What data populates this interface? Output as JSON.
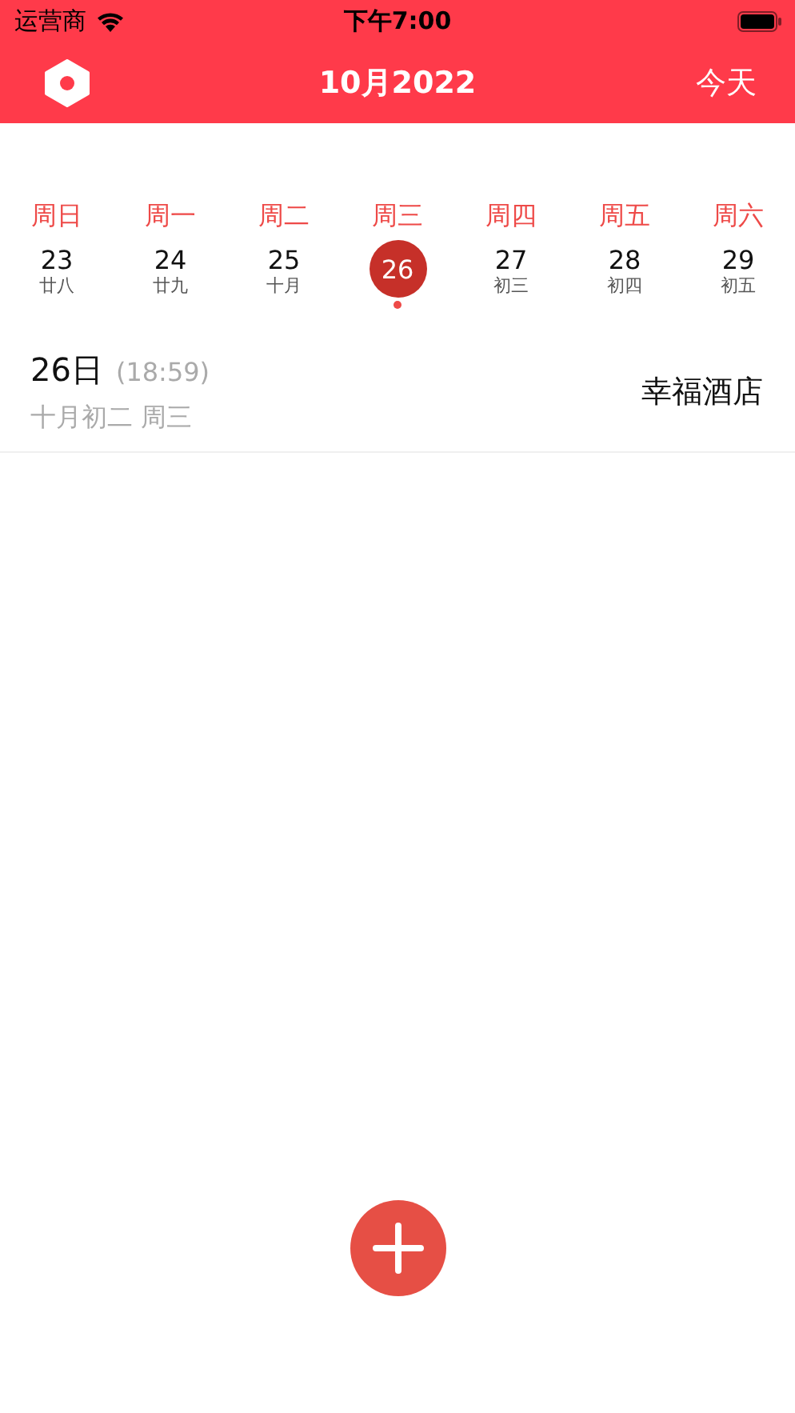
{
  "status_bar": {
    "carrier": "运营商",
    "time": "下午7:00"
  },
  "header": {
    "title": "10月2022",
    "today_button": "今天"
  },
  "weekdays": [
    "周日",
    "周一",
    "周二",
    "周三",
    "周四",
    "周五",
    "周六"
  ],
  "days": [
    {
      "date": "23",
      "lunar": "廿八",
      "selected": false,
      "has_event": false
    },
    {
      "date": "24",
      "lunar": "廿九",
      "selected": false,
      "has_event": false
    },
    {
      "date": "25",
      "lunar": "十月",
      "selected": false,
      "has_event": false
    },
    {
      "date": "26",
      "selected": true,
      "has_event": true
    },
    {
      "date": "27",
      "lunar": "初三",
      "selected": false,
      "has_event": false
    },
    {
      "date": "28",
      "lunar": "初四",
      "selected": false,
      "has_event": false
    },
    {
      "date": "29",
      "lunar": "初五",
      "selected": false,
      "has_event": false
    }
  ],
  "events": [
    {
      "day": "26日",
      "time": "(18:59)",
      "lunar_date": "十月初二 周三",
      "title": "幸福酒店"
    }
  ]
}
